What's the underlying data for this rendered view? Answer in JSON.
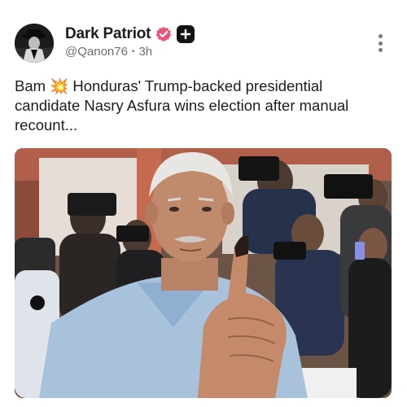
{
  "post": {
    "author": {
      "display_name": "Dark Patriot",
      "handle": "@Qanon76",
      "separator": "•",
      "time_ago": "3h",
      "verified_badge_color": "#e8547a",
      "plus_badge_color": "#121212"
    },
    "text": "Bam 💥 Honduras' Trump-backed presidential candidate Nasry Asfura wins election after manual recount...",
    "more_options_icon": "vertical-ellipsis-icon"
  },
  "colors": {
    "background": "#ffffff",
    "text_primary": "#1c1c1e",
    "text_secondary": "#6e6e73"
  }
}
